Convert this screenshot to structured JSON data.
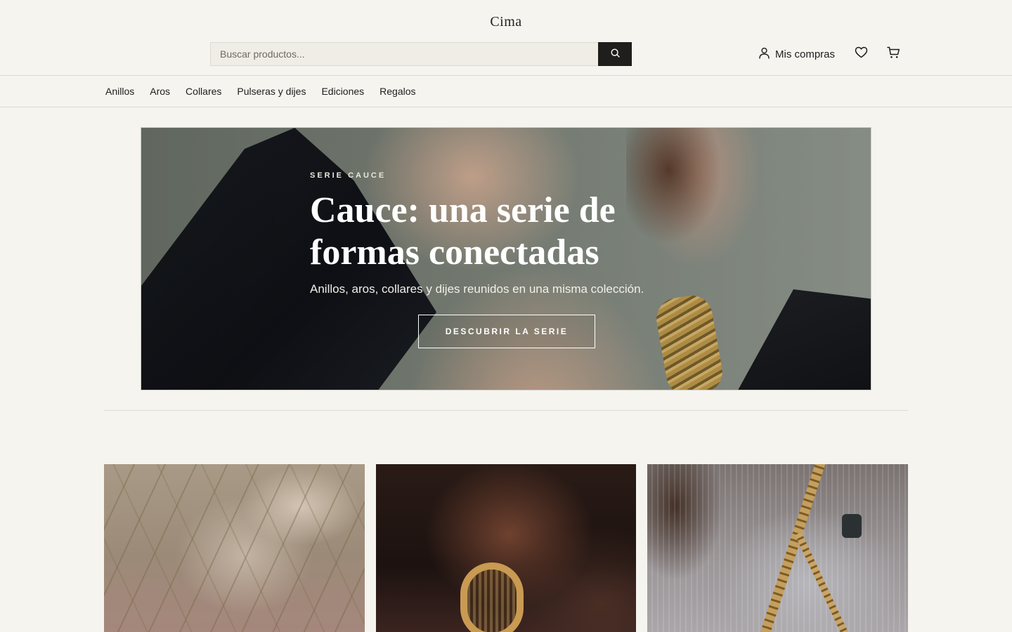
{
  "brand": "Cima",
  "search": {
    "placeholder": "Buscar productos..."
  },
  "account": {
    "label": "Mis compras"
  },
  "nav": {
    "items": [
      "Anillos",
      "Aros",
      "Collares",
      "Pulseras y dijes",
      "Ediciones",
      "Regalos"
    ]
  },
  "hero": {
    "eyebrow": "SERIE CAUCE",
    "title": "Cauce: una serie de formas conectadas",
    "subtitle": "Anillos, aros, collares y dijes reunidos en una misma colección.",
    "cta": "DESCUBRIR LA SERIE"
  },
  "icons": {
    "search": "search-icon",
    "account": "user-icon",
    "wishlist": "heart-icon",
    "cart": "cart-icon"
  },
  "colors": {
    "background": "#f5f4ef",
    "search_button": "#1f1e1c",
    "text": "#1d1d1b"
  }
}
